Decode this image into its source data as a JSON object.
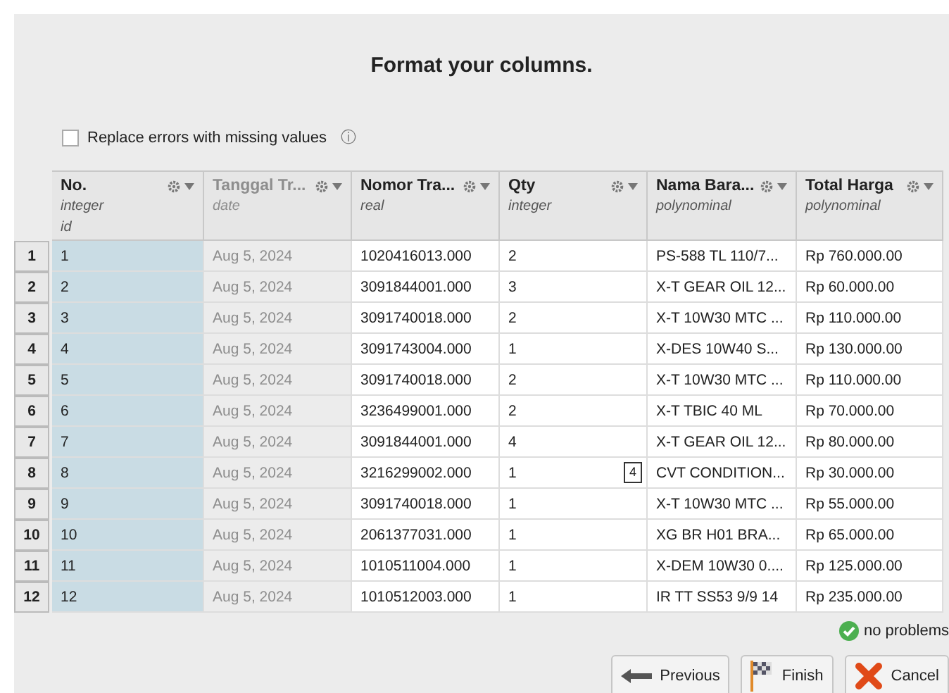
{
  "title": "Format your columns.",
  "replace_errors": {
    "label": "Replace errors with missing values",
    "checked": false,
    "info": "ⓘ"
  },
  "table": {
    "columns": [
      {
        "name": "No.",
        "type": "integer",
        "role": "id",
        "disabled": false,
        "special": true
      },
      {
        "name": "Tanggal Tr...",
        "type": "date",
        "disabled": true,
        "special": false
      },
      {
        "name": "Nomor Tra...",
        "type": "real",
        "disabled": false,
        "special": false
      },
      {
        "name": "Qty",
        "type": "integer",
        "disabled": false,
        "special": false
      },
      {
        "name": "Nama Bara...",
        "type": "polynominal",
        "disabled": false,
        "special": false
      },
      {
        "name": "Total Harga",
        "type": "polynominal",
        "disabled": false,
        "special": false
      }
    ],
    "rows": [
      {
        "index": "1",
        "cells": [
          "1",
          "Aug 5, 2024",
          "1020416013.000",
          "2",
          "PS-588 TL 110/7...",
          "Rp 760.000.00"
        ]
      },
      {
        "index": "2",
        "cells": [
          "2",
          "Aug 5, 2024",
          "3091844001.000",
          "3",
          "X-T GEAR OIL 12...",
          "Rp 60.000.00"
        ]
      },
      {
        "index": "3",
        "cells": [
          "3",
          "Aug 5, 2024",
          "3091740018.000",
          "2",
          "X-T 10W30 MTC ...",
          "Rp 110.000.00"
        ]
      },
      {
        "index": "4",
        "cells": [
          "4",
          "Aug 5, 2024",
          "3091743004.000",
          "1",
          "X-DES 10W40 S...",
          "Rp 130.000.00"
        ]
      },
      {
        "index": "5",
        "cells": [
          "5",
          "Aug 5, 2024",
          "3091740018.000",
          "2",
          "X-T 10W30 MTC ...",
          "Rp 110.000.00"
        ]
      },
      {
        "index": "6",
        "cells": [
          "6",
          "Aug 5, 2024",
          "3236499001.000",
          "2",
          "X-T TBIC 40 ML",
          "Rp 70.000.00"
        ]
      },
      {
        "index": "7",
        "cells": [
          "7",
          "Aug 5, 2024",
          "3091844001.000",
          "4",
          "X-T GEAR OIL 12...",
          "Rp 80.000.00"
        ]
      },
      {
        "index": "8",
        "cells": [
          "8",
          "Aug 5, 2024",
          "3216299002.000",
          "1",
          "CVT CONDITION...",
          "Rp 30.000.00"
        ],
        "tooltip": "4"
      },
      {
        "index": "9",
        "cells": [
          "9",
          "Aug 5, 2024",
          "3091740018.000",
          "1",
          "X-T 10W30 MTC ...",
          "Rp 55.000.00"
        ]
      },
      {
        "index": "10",
        "cells": [
          "10",
          "Aug 5, 2024",
          "2061377031.000",
          "1",
          "XG BR H01 BRA...",
          "Rp 65.000.00"
        ]
      },
      {
        "index": "11",
        "cells": [
          "11",
          "Aug 5, 2024",
          "1010511004.000",
          "1",
          "X-DEM 10W30 0....",
          "Rp 125.000.00"
        ]
      },
      {
        "index": "12",
        "cells": [
          "12",
          "Aug 5, 2024",
          "1010512003.000",
          "1",
          "IR TT SS53 9/9 14",
          "Rp 235.000.00"
        ]
      }
    ]
  },
  "status": {
    "text": "no problems",
    "ok": true
  },
  "buttons": [
    {
      "kind": "previous",
      "label": "Previous"
    },
    {
      "kind": "finish",
      "label": "Finish"
    },
    {
      "kind": "cancel",
      "label": "Cancel"
    }
  ]
}
